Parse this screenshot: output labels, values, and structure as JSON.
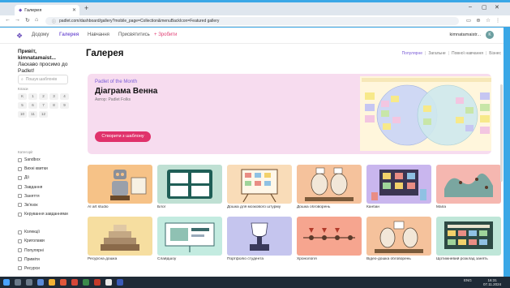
{
  "browser": {
    "tab_title": "Галерея",
    "url": "padlet.com/dashboard/gallery?mobile_page=Collection&menuBackIcon=Featured gallery"
  },
  "topnav": {
    "items": [
      "Додому",
      "Галерея",
      "Навчання",
      "Присвятитись",
      "Зробити"
    ],
    "user_name": "kimnatamaistr...",
    "avatar": "K"
  },
  "sidebar": {
    "greeting_name": "Привіт, kimnatamaist...",
    "greeting_text": "Ласкаво просимо до Padlet!",
    "search_placeholder": "Пошук шаблонів",
    "grades_label": "Класи",
    "grades": [
      "K",
      "1",
      "2",
      "3",
      "4",
      "5",
      "6",
      "7",
      "8",
      "9",
      "10",
      "11",
      "12"
    ],
    "categories_label": "Категорії",
    "categories": [
      "Sandbox",
      "Вихні квитки",
      "Дії",
      "Завдання",
      "Заняття",
      "Зв'язок",
      "Керування завданнями",
      "Колекції",
      "Криголами",
      "Популярні",
      "Приміти",
      "Ресурси"
    ]
  },
  "main": {
    "title": "Галерея",
    "filters": [
      "Популярне",
      "Загальне",
      "Повної навчання",
      "Бізнес"
    ]
  },
  "hero": {
    "kicker": "Padlet of the Month",
    "title": "Діаграма Венна",
    "subtitle": "Автор: Padlet Folks",
    "button": "Створити з шаблону"
  },
  "cards": [
    {
      "label": "AI art studio"
    },
    {
      "label": "Блог"
    },
    {
      "label": "Дошка для мозкового штурму"
    },
    {
      "label": "Дошка обговорень"
    },
    {
      "label": "Канбан"
    },
    {
      "label": "Мапа"
    },
    {
      "label": "Ресурсна дошка"
    },
    {
      "label": "Слайдшоу"
    },
    {
      "label": "Портфоліо студента"
    },
    {
      "label": "Хронологія"
    },
    {
      "label": "Відео-дошка обговорень"
    },
    {
      "label": "Щотижневий розклад занять"
    }
  ],
  "taskbar": {
    "lang": "ENG",
    "time": "16:31",
    "date": "07.11.2024"
  },
  "colors": {
    "accent": "#7a5cd6",
    "cta": "#e0326b",
    "hero_bg": "#f7dcef"
  }
}
